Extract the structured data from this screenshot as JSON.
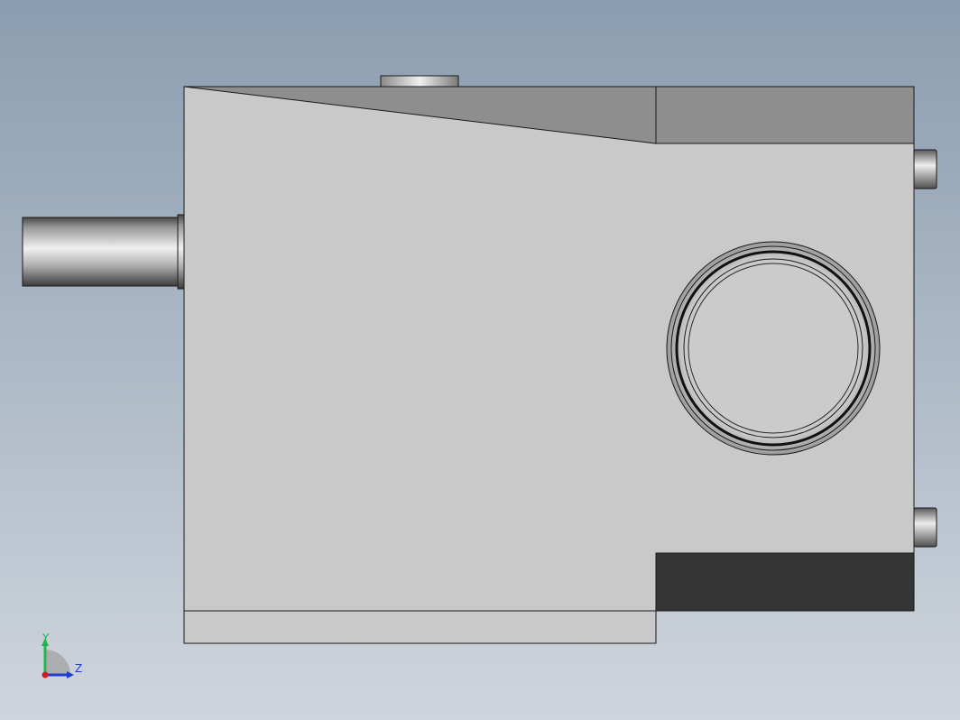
{
  "viewport": {
    "background_top": "#8b9db0",
    "background_bottom": "#cfd5dd"
  },
  "model": {
    "body_color": "#c9c9c9",
    "top_face_color": "#8e8e8e",
    "bottom_recess_color": "#353535",
    "edge_color": "#1a1a1a",
    "shaft_highlight": "#f2f2f2",
    "shaft_shadow": "#3a3a3a"
  },
  "triad": {
    "y_label": "Y",
    "z_label": "Z",
    "y_color": "#1fb64a",
    "z_color": "#1e3ccf",
    "x_color": "#d11b1b"
  }
}
